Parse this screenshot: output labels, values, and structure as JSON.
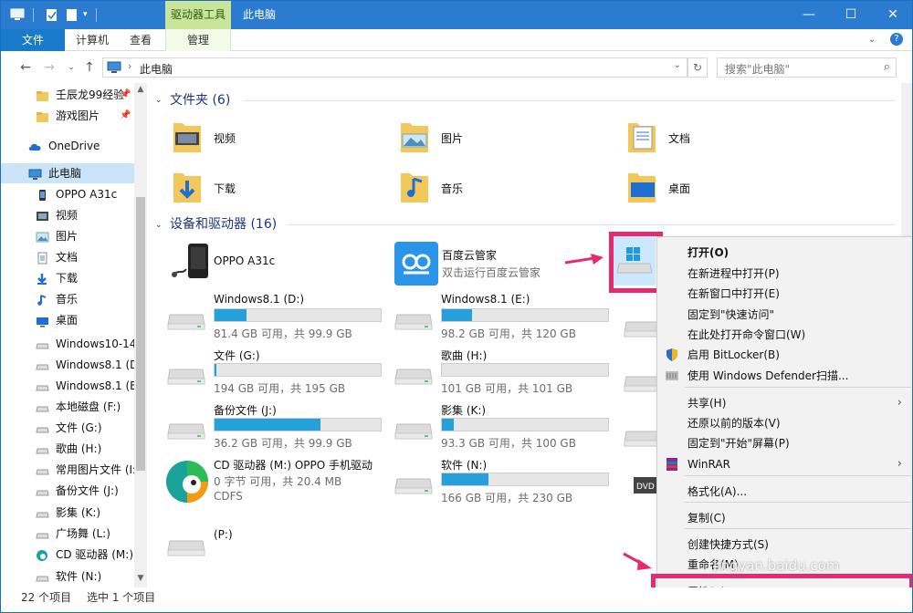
{
  "window": {
    "context_tab": "驱动器工具",
    "title": "此电脑",
    "minimize": "—",
    "maximize": "☐",
    "close": "✕"
  },
  "ribbon": {
    "tabs": [
      "文件",
      "计算机",
      "查看",
      "管理"
    ]
  },
  "address": {
    "path": "此电脑",
    "search_placeholder": "搜索\"此电脑\""
  },
  "nav": {
    "items": [
      {
        "label": "壬辰龙99经验",
        "icon": "folder-icon",
        "pinned": true
      },
      {
        "label": "游戏图片",
        "icon": "folder-icon",
        "pinned": true
      },
      {
        "label": "OneDrive",
        "icon": "cloud-icon"
      },
      {
        "label": "此电脑",
        "icon": "computer-icon",
        "selected": true
      },
      {
        "label": "OPPO A31c",
        "icon": "phone-icon"
      },
      {
        "label": "视频",
        "icon": "video-icon"
      },
      {
        "label": "图片",
        "icon": "picture-icon"
      },
      {
        "label": "文档",
        "icon": "document-icon"
      },
      {
        "label": "下载",
        "icon": "download-icon"
      },
      {
        "label": "音乐",
        "icon": "music-icon"
      },
      {
        "label": "桌面",
        "icon": "desktop-icon"
      },
      {
        "label": "Windows10-14",
        "icon": "drive-icon"
      },
      {
        "label": "Windows8.1 (D",
        "icon": "drive-icon"
      },
      {
        "label": "Windows8.1 (E",
        "icon": "drive-icon"
      },
      {
        "label": "本地磁盘 (F:)",
        "icon": "drive-icon"
      },
      {
        "label": "文件 (G:)",
        "icon": "drive-icon"
      },
      {
        "label": "歌曲 (H:)",
        "icon": "drive-icon"
      },
      {
        "label": "常用图片文件 (I:",
        "icon": "drive-icon"
      },
      {
        "label": "备份文件 (J:)",
        "icon": "drive-icon"
      },
      {
        "label": "影集 (K:)",
        "icon": "drive-icon"
      },
      {
        "label": "广场舞 (L:)",
        "icon": "drive-icon"
      },
      {
        "label": "CD 驱动器 (M:)",
        "icon": "cd-icon"
      },
      {
        "label": "软件 (N:)",
        "icon": "drive-icon"
      }
    ]
  },
  "folders_group": {
    "heading": "文件夹 (6)",
    "items": [
      "视频",
      "图片",
      "文档",
      "下载",
      "音乐",
      "桌面"
    ]
  },
  "devices_group": {
    "heading": "设备和驱动器 (16)",
    "phone": {
      "name": "OPPO A31c"
    },
    "baidu": {
      "name": "百度云管家",
      "desc": "双击运行百度云管家"
    },
    "drives": [
      {
        "name": "Windows8.1 (D:)",
        "free": "81.4 GB 可用，共 99.9 GB",
        "used_fraction": 0.19
      },
      {
        "name": "Windows8.1 (E:)",
        "free": "98.2 GB 可用，共 120 GB",
        "used_fraction": 0.18
      },
      {
        "name": "文件 (G:)",
        "free": "194 GB 可用，共 195 GB",
        "used_fraction": 0.01
      },
      {
        "name": "歌曲 (H:)",
        "free": "101 GB 可用，共 101 GB",
        "used_fraction": 0.0
      },
      {
        "name": "备份文件 (J:)",
        "free": "36.2 GB 可用，共 99.9 GB",
        "used_fraction": 0.64
      },
      {
        "name": "影集 (K:)",
        "free": "93.3 GB 可用，共 100 GB",
        "used_fraction": 0.07
      },
      {
        "name": "软件 (N:)",
        "free": "166 GB 可用，共 230 GB",
        "used_fraction": 0.28
      }
    ],
    "cd": {
      "name": "CD 驱动器 (M:) OPPO 手机驱动",
      "free": "0 字节 可用，共 20.4 MB",
      "fs": "CDFS"
    },
    "p_drive": {
      "name": "(P:)"
    }
  },
  "context_menu": {
    "items": [
      {
        "label": "打开(O)",
        "bold": true
      },
      {
        "label": "在新进程中打开(P)"
      },
      {
        "label": "在新窗口中打开(E)"
      },
      {
        "label": "固定到\"快速访问\""
      },
      {
        "label": "在此处打开命令窗口(W)"
      },
      {
        "label": "启用 BitLocker(B)",
        "icon": "shield-icon"
      },
      {
        "label": "使用 Windows Defender扫描...",
        "icon": "defender-icon"
      },
      {
        "label": "共享(H)",
        "submenu": true
      },
      {
        "label": "还原以前的版本(V)"
      },
      {
        "label": "固定到\"开始\"屏幕(P)"
      },
      {
        "label": "WinRAR",
        "icon": "winrar-icon",
        "submenu": true
      },
      {
        "label": "格式化(A)..."
      },
      {
        "label": "复制(C)"
      },
      {
        "label": "创建快捷方式(S)"
      },
      {
        "label": "重命名(M)"
      },
      {
        "label": "属性(R)"
      }
    ]
  },
  "status": {
    "count": "22 个项目",
    "selected": "选中 1 个项目"
  },
  "watermark": "jingyan.baidu.com",
  "colors": {
    "accent": "#2b7bd0",
    "highlight": "#e52a6f",
    "bar_fill": "#26a0da"
  }
}
